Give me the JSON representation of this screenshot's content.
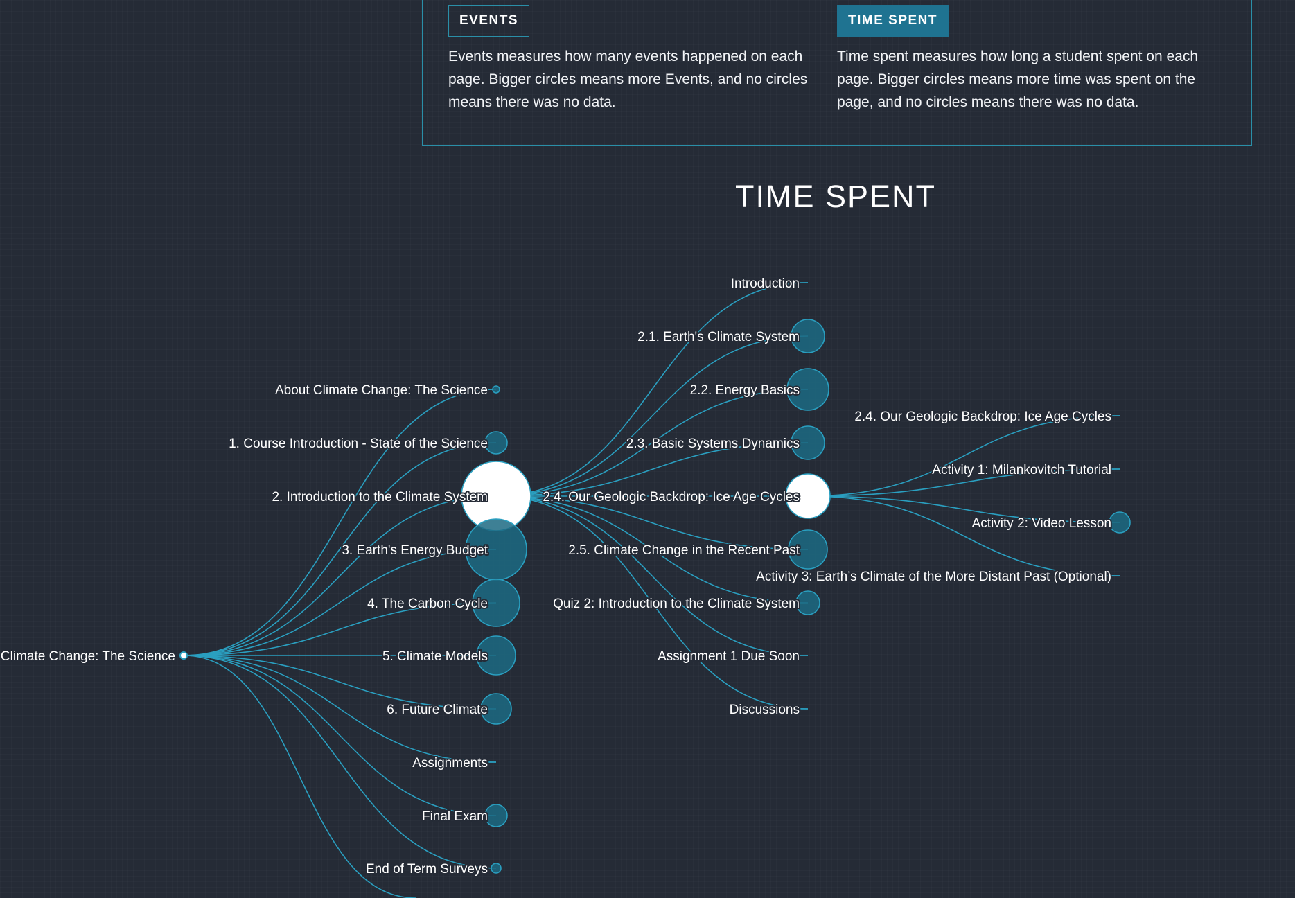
{
  "legend": {
    "events": {
      "label": "EVENTS",
      "description": "Events measures how many events happened on each page. Bigger circles means more Events, and no circles means there was no data."
    },
    "time_spent": {
      "label": "TIME SPENT",
      "description": "Time spent measures how long a student spent on each page. Bigger circles means more time was spent on the page, and no circles means there was no data."
    }
  },
  "chart_title": "TIME SPENT",
  "colors": {
    "background": "#252b36",
    "link": "#2a9fc0",
    "node_fill": "#1c6a83",
    "node_stroke": "#2a9fc0",
    "selected_fill": "#ffffff",
    "accent": "#1f7391"
  },
  "tree": {
    "root": {
      "name": "Climate Change: The Science"
    },
    "sections": [
      {
        "name": "About Climate Change: The Science"
      },
      {
        "name": "1. Course Introduction - State of the Science"
      },
      {
        "name": "2. Introduction to the Climate System",
        "expanded": true
      },
      {
        "name": "3. Earth's Energy Budget"
      },
      {
        "name": "4. The Carbon Cycle"
      },
      {
        "name": "5. Climate Models"
      },
      {
        "name": "6. Future Climate"
      },
      {
        "name": "Assignments"
      },
      {
        "name": "Final Exam"
      },
      {
        "name": "End of Term Surveys"
      }
    ],
    "section_2_children": [
      {
        "name": "Introduction"
      },
      {
        "name": "2.1. Earth's Climate System"
      },
      {
        "name": "2.2. Energy Basics"
      },
      {
        "name": "2.3. Basic Systems Dynamics"
      },
      {
        "name": "2.4. Our Geologic Backdrop: Ice Age Cycles",
        "expanded": true
      },
      {
        "name": "2.5. Climate Change in the Recent Past"
      },
      {
        "name": "Quiz 2: Introduction to the Climate System"
      },
      {
        "name": "Assignment 1 Due Soon"
      },
      {
        "name": "Discussions"
      }
    ],
    "section_2_4_children": [
      {
        "name": "2.4. Our Geologic Backdrop: Ice Age Cycles"
      },
      {
        "name": "Activity 1: Milankovitch Tutorial"
      },
      {
        "name": "Activity 2: Video Lesson"
      },
      {
        "name": "Activity 3: Earth’s Climate of the More Distant Past (Optional)"
      }
    ]
  }
}
